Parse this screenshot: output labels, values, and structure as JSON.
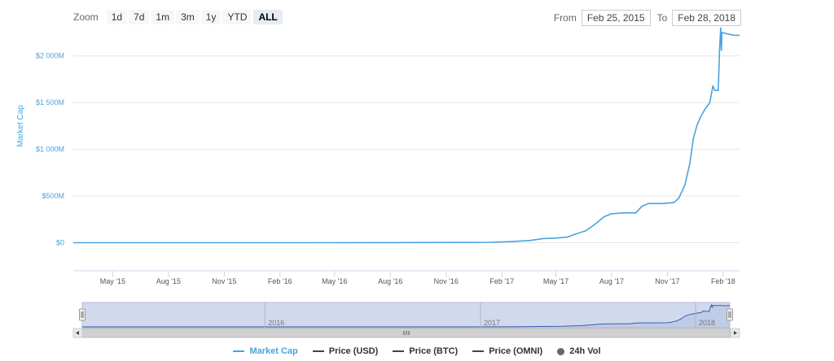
{
  "zoom": {
    "label": "Zoom",
    "buttons": [
      "1d",
      "7d",
      "1m",
      "3m",
      "1y",
      "YTD",
      "ALL"
    ],
    "active": "ALL"
  },
  "range": {
    "from_label": "From",
    "from_value": "Feb 25, 2015",
    "to_label": "To",
    "to_value": "Feb 28, 2018"
  },
  "colors": {
    "series": "#4aa3df",
    "navigator_fill": "#c9d3ea",
    "grid": "#e6e6e6"
  },
  "chart_data": {
    "type": "line",
    "title": "",
    "ylabel": "Market Cap",
    "xlabel": "",
    "ylim_millions": [
      -300,
      2250
    ],
    "y_ticks": [
      {
        "value": 0,
        "label": "$0"
      },
      {
        "value": 500,
        "label": "$500M"
      },
      {
        "value": 1000,
        "label": "$1 000M"
      },
      {
        "value": 1500,
        "label": "$1 500M"
      },
      {
        "value": 2000,
        "label": "$2 000M"
      }
    ],
    "x_range": [
      "2015-02-25",
      "2018-02-28"
    ],
    "x_ticks": [
      {
        "date": "2015-05-01",
        "label": "May '15"
      },
      {
        "date": "2015-08-01",
        "label": "Aug '15"
      },
      {
        "date": "2015-11-01",
        "label": "Nov '15"
      },
      {
        "date": "2016-02-01",
        "label": "Feb '16"
      },
      {
        "date": "2016-05-01",
        "label": "May '16"
      },
      {
        "date": "2016-08-01",
        "label": "Aug '16"
      },
      {
        "date": "2016-11-01",
        "label": "Nov '16"
      },
      {
        "date": "2017-02-01",
        "label": "Feb '17"
      },
      {
        "date": "2017-05-01",
        "label": "May '17"
      },
      {
        "date": "2017-08-01",
        "label": "Aug '17"
      },
      {
        "date": "2017-11-01",
        "label": "Nov '17"
      },
      {
        "date": "2018-02-01",
        "label": "Feb '18"
      }
    ],
    "series": [
      {
        "name": "Market Cap",
        "unit": "USD millions",
        "points": [
          [
            "2015-02-25",
            0
          ],
          [
            "2015-06-01",
            0
          ],
          [
            "2015-10-01",
            0
          ],
          [
            "2016-01-01",
            0
          ],
          [
            "2016-04-01",
            0
          ],
          [
            "2016-08-01",
            1
          ],
          [
            "2016-12-01",
            3
          ],
          [
            "2017-01-15",
            5
          ],
          [
            "2017-02-15",
            12
          ],
          [
            "2017-03-10",
            20
          ],
          [
            "2017-03-20",
            25
          ],
          [
            "2017-04-10",
            45
          ],
          [
            "2017-05-01",
            50
          ],
          [
            "2017-05-20",
            60
          ],
          [
            "2017-06-01",
            90
          ],
          [
            "2017-06-20",
            130
          ],
          [
            "2017-07-05",
            200
          ],
          [
            "2017-07-20",
            280
          ],
          [
            "2017-08-01",
            310
          ],
          [
            "2017-08-20",
            320
          ],
          [
            "2017-09-10",
            320
          ],
          [
            "2017-09-20",
            390
          ],
          [
            "2017-10-01",
            420
          ],
          [
            "2017-10-25",
            420
          ],
          [
            "2017-11-12",
            430
          ],
          [
            "2017-11-20",
            480
          ],
          [
            "2017-11-30",
            620
          ],
          [
            "2017-12-08",
            850
          ],
          [
            "2017-12-14",
            1120
          ],
          [
            "2017-12-20",
            1260
          ],
          [
            "2017-12-26",
            1350
          ],
          [
            "2018-01-03",
            1440
          ],
          [
            "2018-01-10",
            1500
          ],
          [
            "2018-01-15",
            1680
          ],
          [
            "2018-01-18",
            1630
          ],
          [
            "2018-01-24",
            1630
          ],
          [
            "2018-01-26",
            2050
          ],
          [
            "2018-01-28",
            2300
          ],
          [
            "2018-01-29",
            2060
          ],
          [
            "2018-01-30",
            2250
          ],
          [
            "2018-02-05",
            2240
          ],
          [
            "2018-02-12",
            2230
          ],
          [
            "2018-02-20",
            2220
          ],
          [
            "2018-02-28",
            2220
          ]
        ]
      }
    ],
    "navigator": {
      "year_labels": [
        {
          "date": "2016-01-01",
          "label": "2016"
        },
        {
          "date": "2017-01-01",
          "label": "2017"
        },
        {
          "date": "2018-01-01",
          "label": "2018"
        }
      ]
    }
  },
  "legend": {
    "items": [
      {
        "label": "Market Cap",
        "marker": "line",
        "active": true
      },
      {
        "label": "Price (USD)",
        "marker": "line",
        "active": false
      },
      {
        "label": "Price (BTC)",
        "marker": "line",
        "active": false
      },
      {
        "label": "Price (OMNI)",
        "marker": "line",
        "active": false
      },
      {
        "label": "24h Vol",
        "marker": "dot",
        "active": false
      }
    ]
  }
}
